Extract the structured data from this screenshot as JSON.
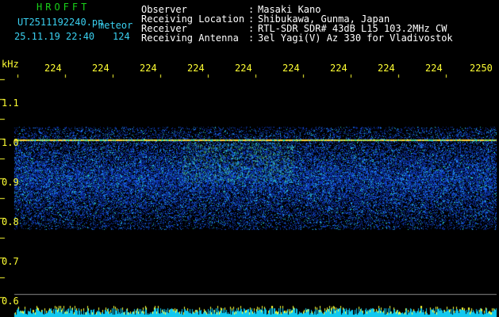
{
  "brand": "HROFFT",
  "file_name": "UT2511192240.pn",
  "meteor_label": "meteor",
  "datetime": "25.11.19 22:40",
  "count": "124",
  "info": [
    {
      "label": "Observer",
      "value": "Masaki Kano"
    },
    {
      "label": "Receiving Location",
      "value": "Shibukawa, Gunma, Japan"
    },
    {
      "label": "Receiver",
      "value": "RTL-SDR SDR# 43dB L15 103.2MHz CW"
    },
    {
      "label": "Receiving Antenna",
      "value": "3el Yagi(V) Az 330 for Vladivostok"
    }
  ],
  "axis_unit": "kHz",
  "x_ticks": [
    "224",
    "224",
    "224",
    "224",
    "224",
    "224",
    "224",
    "224",
    "224",
    "2250"
  ],
  "y_ticks": [
    "1.1",
    "1.0",
    "0.9",
    "0.8",
    "0.7",
    "0.6"
  ],
  "colors": {
    "header": "#ffffff",
    "brand": "#19d119",
    "info": "#3ad0f0",
    "axis": "#ffff33"
  }
}
